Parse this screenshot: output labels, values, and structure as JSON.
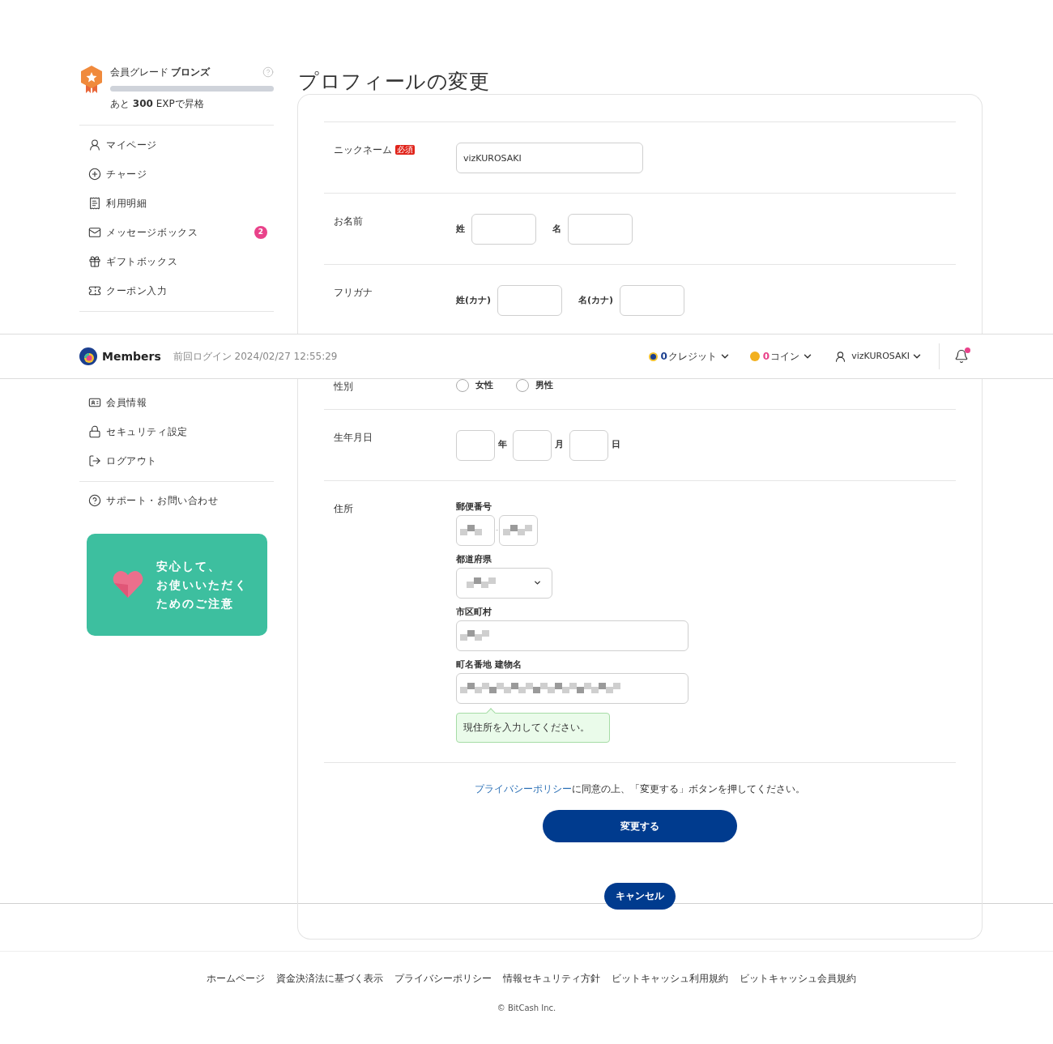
{
  "sidebar": {
    "grade": {
      "label": "会員グレード",
      "name": "ブロンズ",
      "level": 0,
      "note": "あと **300** EXPで昇格"
    },
    "menu_top": [
      {
        "label": "マイページ"
      },
      {
        "label": "チャージ"
      },
      {
        "label": "利用明細"
      },
      {
        "label": "メッセージボックス",
        "badge": "2"
      },
      {
        "label": "ギフトボックス"
      },
      {
        "label": "クーポン入力"
      }
    ],
    "menu_bottom": [
      {
        "label": "会員情報"
      },
      {
        "label": "セキュリティ設定"
      },
      {
        "label": "ログアウト"
      }
    ],
    "support": "サポート・お問い合わせ",
    "banner": [
      "安心して、",
      "お使いいただく",
      "ためのご注意"
    ]
  },
  "header": {
    "brand": "Members",
    "last_login": "前回ログイン 2024/02/27 12:55:29",
    "credit": {
      "value": "0",
      "unit": "クレジット"
    },
    "coin": {
      "value": "0",
      "unit": "コイン"
    },
    "user": "vizKUROSAKI"
  },
  "title": "プロフィールの変更",
  "rows_top": [
    {
      "kind": "text",
      "label": "ニックネーム",
      "badge": "必須",
      "value": "vizKUROSAKI"
    },
    {
      "kind": "name",
      "label": "お名前",
      "parts": [
        "姓",
        "名"
      ]
    },
    {
      "kind": "name",
      "label": "フリガナ",
      "parts": [
        "姓(カナ)",
        "名(カナ)"
      ]
    }
  ],
  "rows_bottom": [
    {
      "kind": "radio",
      "label": "性別",
      "options": [
        {
          "label": "女性",
          "selected": false
        },
        {
          "label": "男性",
          "selected": false
        }
      ]
    },
    {
      "kind": "date",
      "label": "生年月日",
      "units": [
        "年",
        "月",
        "日"
      ]
    },
    {
      "kind": "address",
      "label": "住所",
      "fields": [
        {
          "kind": "postal",
          "label": "郵便番号",
          "separator": "-"
        },
        {
          "kind": "select",
          "label": "都道府県"
        },
        {
          "kind": "text",
          "label": "市区町村"
        },
        {
          "kind": "text",
          "label": "町名番地 建物名",
          "hint": "現住所を入力してください。"
        }
      ]
    }
  ],
  "consent": {
    "link": "プライバシーポリシー",
    "text": "に同意の上、「変更する」ボタンを押してください。"
  },
  "submit": "変更する",
  "cancel": "キャンセル",
  "footer": {
    "links": [
      "ホームページ",
      "資金決済法に基づく表示",
      "プライバシーポリシー",
      "情報セキュリティ方針",
      "ビットキャッシュ利用規約",
      "ビットキャッシュ会員規約"
    ],
    "copyright": "© BitCash Inc."
  }
}
